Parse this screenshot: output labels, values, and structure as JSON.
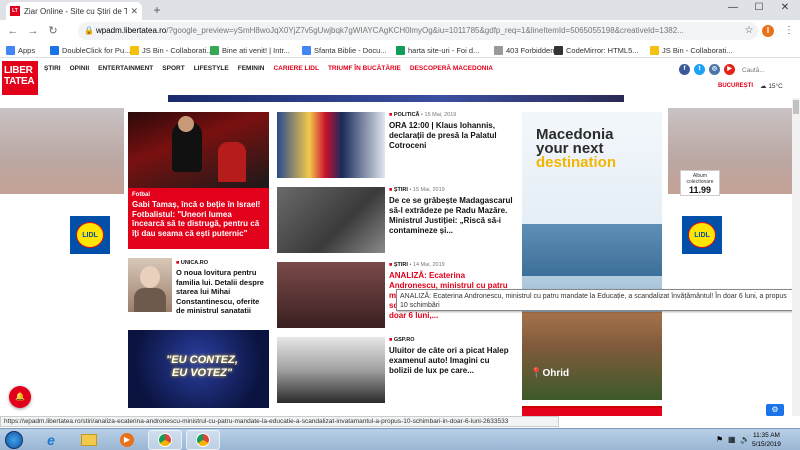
{
  "browser": {
    "tab_title": "Ziar Online - Site cu Știri de Top ×",
    "tab_title_text": "Ziar Online - Site cu Știri de Top",
    "url_domain": "wpadm.libertatea.ro",
    "url_rest": "/?google_preview=ySmH8woJqX0YjZ7v5gUwjbqk7gWIAYCAgKCH0lmyOg&iu=1011785&gdfp_req=1&lineItemId=5065055198&creativeId=1382...",
    "avatar_letter": "I"
  },
  "bookmarks": [
    {
      "label": "Apps",
      "color": "#4285f4"
    },
    {
      "label": "DoubleClick for Pu...",
      "color": "#1a73e8"
    },
    {
      "label": "JS Bin - Collaborati...",
      "color": "#f4c20d"
    },
    {
      "label": "Bine ati venit! | Intr...",
      "color": "#34a853"
    },
    {
      "label": "Sfanta Biblie - Docu...",
      "color": "#4285f4"
    },
    {
      "label": "harta site-uri - Foi d...",
      "color": "#0f9d58"
    },
    {
      "label": "403 Forbidden",
      "color": "#999999"
    },
    {
      "label": "CodeMirror: HTML5...",
      "color": "#333333"
    },
    {
      "label": "JS Bin - Collaborati...",
      "color": "#f4c20d"
    }
  ],
  "site": {
    "logo_line1": "LIBER",
    "logo_line2": "TATEA",
    "nav": [
      "ȘTIRI",
      "OPINII",
      "ENTERTAINMENT",
      "SPORT",
      "LIFESTYLE",
      "FEMININ"
    ],
    "nav_red": [
      "CARIERE LIDL",
      "TRIUMF ÎN BUCĂTĂRIE",
      "DESCOPERĂ MACEDONIA"
    ],
    "search_placeholder": "Caută...",
    "city": "BUCUREȘTI",
    "temperature": "15°C",
    "lidl_label": "LIDL"
  },
  "articles": {
    "feature": {
      "category": "Fotbal",
      "title": "Gabi Tamaș, încă o beție în Israel! Fotbalistul: \"Uneori lumea încearcă să te distrugă, pentru că îți dau seama că ești puternic\""
    },
    "unica": {
      "kicker": "UNICA.RO",
      "title": "O noua lovitura pentru familia lui. Detalii despre starea lui Mihai Constantinescu, oferite de ministrul sanatatii"
    },
    "vote_banner_line1": "\"EU CONTEZ,",
    "vote_banner_line2": "EU VOTEZ\"",
    "list": [
      {
        "kicker": "POLITICĂ",
        "date": "15 Mai, 2019",
        "title": "ORA 12:00 | Klaus Iohannis, declarații de presă la Palatul Cotroceni",
        "red": false
      },
      {
        "kicker": "ȘTIRI",
        "date": "15 Mai, 2019",
        "title": "De ce se grăbește Madagascarul să-l extrădeze pe Radu Mazăre. Ministrul Justiției: „Riscă să-i contamineze și...",
        "red": false
      },
      {
        "kicker": "ȘTIRI",
        "date": "14 Mai, 2019",
        "title": "ANALIZĂ: Ecaterina Andronescu, ministrul cu patru mandate la Educație, a scandalizat învățământul! În doar 6 luni,...",
        "red": true
      },
      {
        "kicker": "GSP.RO",
        "date": "",
        "title": "Uluitor de câte ori a picat Halep examenul auto! Imagini cu bolizii de lux pe care...",
        "red": false
      }
    ]
  },
  "ad": {
    "title_line1": "Macedonia",
    "title_line2": "your next",
    "title_line3": "destination",
    "album_label": "Album colectionare",
    "price": "11.99",
    "ohrid": "Ohrid"
  },
  "tooltip": "ANALIZĂ: Ecaterina Andronescu, ministrul cu patru mandate la Educație, a scandalizat învățământul! În doar 6 luni, a propus 10 schimbări",
  "status_url": "https://wpadm.libertatea.ro/stiri/analiza-ecaterina-andronescu-ministrul-cu-patru-mandate-la-educatie-a-scandalizat-invatamantul-a-propus-10-schimbari-in-doar-6-luni-2633533",
  "clock": {
    "time": "11:35 AM",
    "date": "5/15/2019"
  },
  "notification_count": "1"
}
